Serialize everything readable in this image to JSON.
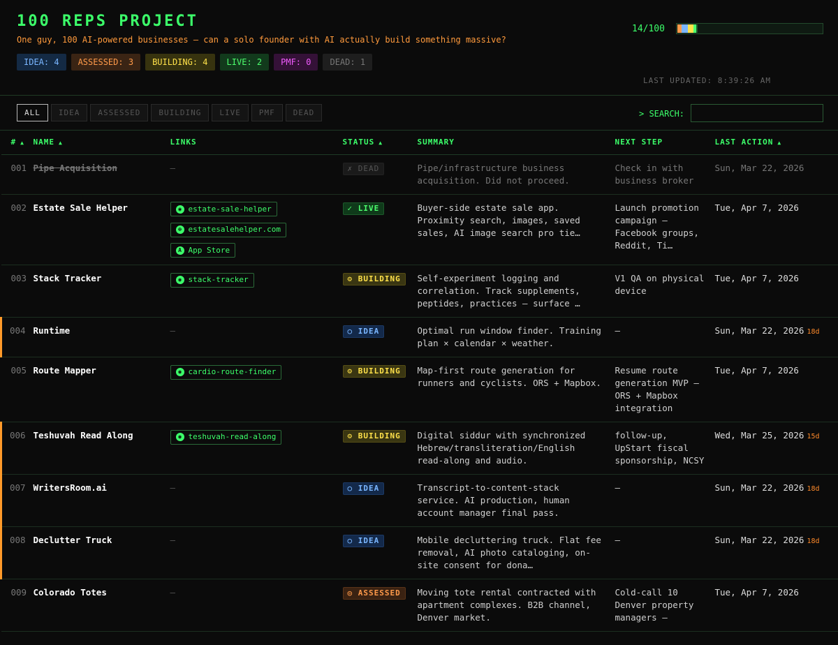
{
  "header": {
    "title": "100 REPS PROJECT",
    "subtitle": "One guy, 100 AI-powered businesses — can a solo founder with AI actually build something massive?",
    "progress_label": "14/100",
    "progress_fraction": 0.14,
    "progress_segments": [
      {
        "status": "assessed",
        "color": "#ff9a4a",
        "count": 3
      },
      {
        "status": "idea",
        "color": "#7ab6ff",
        "count": 4
      },
      {
        "status": "building",
        "color": "#ffe14a",
        "count": 4
      },
      {
        "status": "live",
        "color": "#4dff6e",
        "count": 2
      },
      {
        "status": "dead",
        "color": "#1f5a2a",
        "count": 1
      }
    ],
    "last_updated": "LAST UPDATED: 8:39:26 AM",
    "badges": {
      "idea": "IDEA: 4",
      "assessed": "ASSESSED: 3",
      "building": "BUILDING: 4",
      "live": "LIVE: 2",
      "pmf": "PMF: 0",
      "dead": "DEAD: 1"
    }
  },
  "filters": {
    "all": "ALL",
    "idea": "IDEA",
    "assessed": "ASSESSED",
    "building": "BUILDING",
    "live": "LIVE",
    "pmf": "PMF",
    "dead": "DEAD",
    "active": "ALL"
  },
  "search": {
    "label": "> SEARCH:",
    "value": "",
    "placeholder": ""
  },
  "table": {
    "headers": {
      "num": "#",
      "name": "NAME",
      "links": "LINKS",
      "status": "STATUS",
      "summary": "SUMMARY",
      "next": "NEXT STEP",
      "last": "LAST ACTION"
    },
    "sort_arrow": "▲",
    "empty_mark": "—",
    "rows": [
      {
        "num": "001",
        "name": "Pipe Acquisition",
        "links": [],
        "status": "✗ DEAD",
        "summary": "Pipe/infrastructure business acquisition. Did not proceed.",
        "next": "Check in with business broker",
        "date": "Sun, Mar 22, 2026",
        "stale": ""
      },
      {
        "num": "002",
        "name": "Estate Sale Helper",
        "links": [
          {
            "icon": "github-icon",
            "glyph": "◉",
            "label": "estate-sale-helper"
          },
          {
            "icon": "globe-icon",
            "glyph": "⊕",
            "label": "estatesalehelper.com"
          },
          {
            "icon": "app-store-icon",
            "glyph": "A",
            "label": "App Store"
          }
        ],
        "status": "✓ LIVE",
        "summary": "Buyer-side estate sale app. Proximity search, images, saved sales, AI image search pro tie…",
        "next": "Launch promotion campaign — Facebook groups, Reddit, Ti…",
        "date": "Tue, Apr 7, 2026",
        "stale": ""
      },
      {
        "num": "003",
        "name": "Stack Tracker",
        "links": [
          {
            "icon": "github-icon",
            "glyph": "◉",
            "label": "stack-tracker"
          }
        ],
        "status": "⚙ BUILDING",
        "summary": "Self-experiment logging and correlation. Track supplements, peptides, practices — surface …",
        "next": "V1 QA on physical device",
        "date": "Tue, Apr 7, 2026",
        "stale": ""
      },
      {
        "num": "004",
        "name": "Runtime",
        "links": [],
        "status": "○ IDEA",
        "summary": "Optimal run window finder. Training plan × calendar × weather.",
        "next": "—",
        "date": "Sun, Mar 22, 2026",
        "stale": "18d"
      },
      {
        "num": "005",
        "name": "Route Mapper",
        "links": [
          {
            "icon": "github-icon",
            "glyph": "◉",
            "label": "cardio-route-finder"
          }
        ],
        "status": "⚙ BUILDING",
        "summary": "Map-first route generation for runners and cyclists. ORS + Mapbox.",
        "next": "Resume route generation MVP — ORS + Mapbox integration",
        "date": "Tue, Apr 7, 2026",
        "stale": ""
      },
      {
        "num": "006",
        "name": "Teshuvah Read Along",
        "links": [
          {
            "icon": "github-icon",
            "glyph": "◉",
            "label": "teshuvah-read-along"
          }
        ],
        "status": "⚙ BUILDING",
        "summary": "Digital siddur with synchronized Hebrew/transliteration/English read-along and audio.",
        "next": "follow-up, UpStart fiscal sponsorship, NCSY",
        "date": "Wed, Mar 25, 2026",
        "stale": "15d"
      },
      {
        "num": "007",
        "name": "WritersRoom.ai",
        "links": [],
        "status": "○ IDEA",
        "summary": "Transcript-to-content-stack service. AI production, human account manager final pass.",
        "next": "—",
        "date": "Sun, Mar 22, 2026",
        "stale": "18d"
      },
      {
        "num": "008",
        "name": "Declutter Truck",
        "links": [],
        "status": "○ IDEA",
        "summary": "Mobile decluttering truck. Flat fee removal, AI photo cataloging, on-site consent for dona…",
        "next": "—",
        "date": "Sun, Mar 22, 2026",
        "stale": "18d"
      },
      {
        "num": "009",
        "name": "Colorado Totes",
        "links": [],
        "status": "◎ ASSESSED",
        "summary": "Moving tote rental contracted with apartment complexes. B2B channel, Denver market.",
        "next": "Cold-call 10 Denver property managers —",
        "date": "Tue, Apr 7, 2026",
        "stale": ""
      }
    ]
  }
}
